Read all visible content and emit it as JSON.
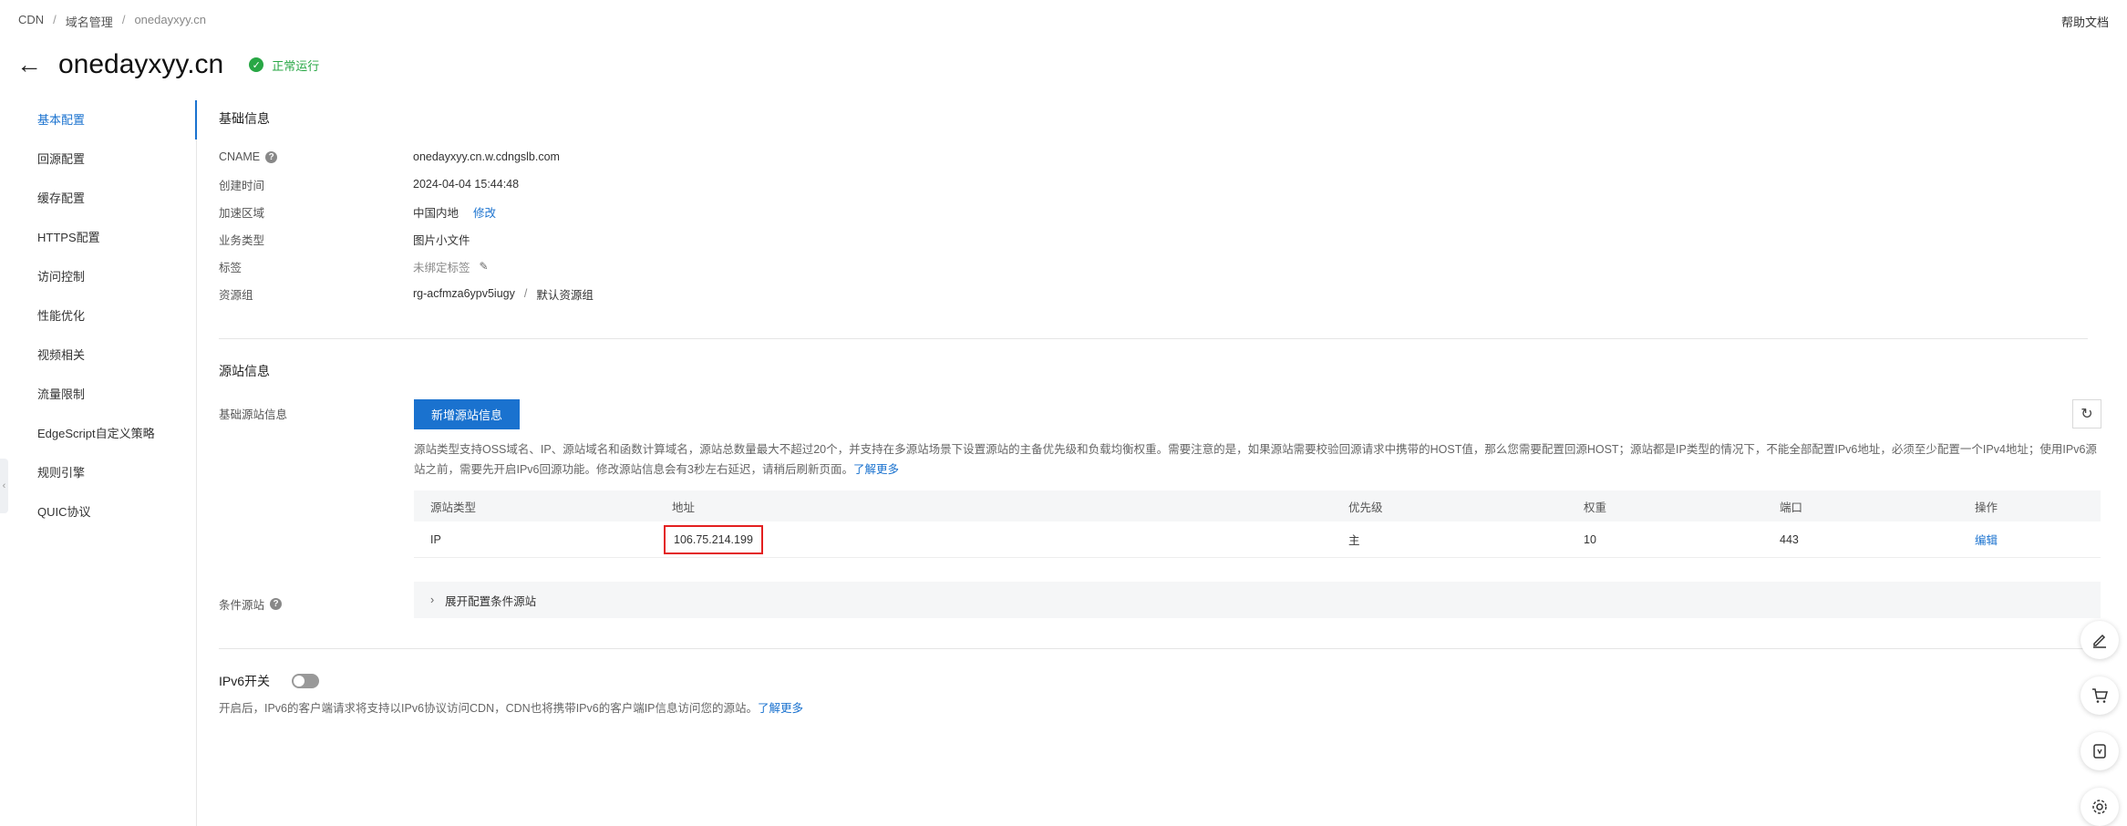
{
  "breadcrumb": [
    "CDN",
    "域名管理",
    "onedayxyy.cn"
  ],
  "help_link": "帮助文档",
  "domain": "onedayxyy.cn",
  "status": "正常运行",
  "sidebar": {
    "items": [
      {
        "label": "基本配置",
        "active": true
      },
      {
        "label": "回源配置"
      },
      {
        "label": "缓存配置"
      },
      {
        "label": "HTTPS配置"
      },
      {
        "label": "访问控制"
      },
      {
        "label": "性能优化"
      },
      {
        "label": "视频相关"
      },
      {
        "label": "流量限制"
      },
      {
        "label": "EdgeScript自定义策略"
      },
      {
        "label": "规则引擎"
      },
      {
        "label": "QUIC协议"
      }
    ]
  },
  "basic": {
    "title": "基础信息",
    "cname_label": "CNAME",
    "cname_value": "onedayxyy.cn.w.cdngslb.com",
    "created_label": "创建时间",
    "created_value": "2024-04-04 15:44:48",
    "region_label": "加速区域",
    "region_value": "中国内地",
    "region_edit": "修改",
    "biz_label": "业务类型",
    "biz_value": "图片小文件",
    "tag_label": "标签",
    "tag_value": "未绑定标签",
    "rg_label": "资源组",
    "rg_value": "rg-acfmza6ypv5iugy",
    "rg_sep": "/",
    "rg_name": "默认资源组"
  },
  "origin": {
    "title": "源站信息",
    "basic_label": "基础源站信息",
    "add_button": "新增源站信息",
    "desc": "源站类型支持OSS域名、IP、源站域名和函数计算域名，源站总数量最大不超过20个，并支持在多源站场景下设置源站的主备优先级和负载均衡权重。需要注意的是，如果源站需要校验回源请求中携带的HOST值，那么您需要配置回源HOST；源站都是IP类型的情况下，不能全部配置IPv6地址，必须至少配置一个IPv4地址；使用IPv6源站之前，需要先开启IPv6回源功能。修改源站信息会有3秒左右延迟，请稍后刷新页面。",
    "learn_more": "了解更多",
    "columns": [
      "源站类型",
      "地址",
      "优先级",
      "权重",
      "端口",
      "操作"
    ],
    "rows": [
      {
        "type": "IP",
        "address": "106.75.214.199",
        "priority": "主",
        "weight": "10",
        "port": "443",
        "action": "编辑"
      }
    ],
    "cond_label": "条件源站",
    "cond_expand": "展开配置条件源站"
  },
  "ipv6": {
    "label": "IPv6开关",
    "enabled": false,
    "desc": "开启后，IPv6的客户端请求将支持以IPv6协议访问CDN，CDN也将携带IPv6的客户端IP信息访问您的源站。",
    "learn_more": "了解更多"
  }
}
